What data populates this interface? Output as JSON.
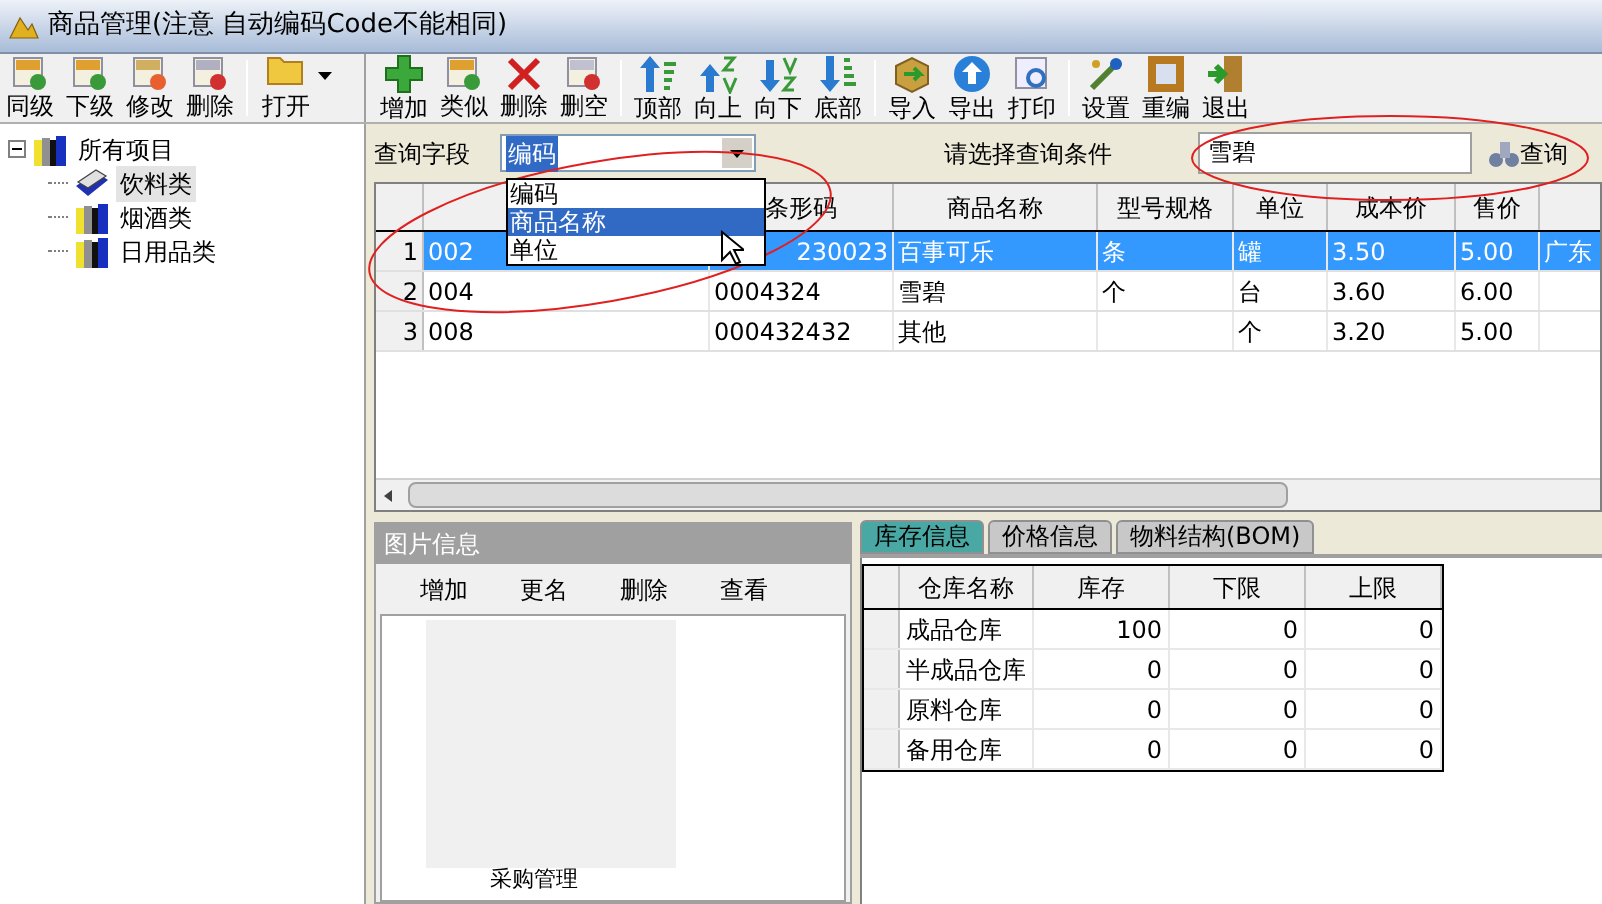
{
  "window": {
    "title": "商品管理(注意 自动编码Code不能相同)"
  },
  "tree_toolbar": {
    "buttons": [
      "同级",
      "下级",
      "修改",
      "删除"
    ],
    "open_button": "打开"
  },
  "main_toolbar": {
    "groups": [
      [
        "增加",
        "类似",
        "删除",
        "删空"
      ],
      [
        "顶部",
        "向上",
        "向下",
        "底部"
      ],
      [
        "导入",
        "导出",
        "打印"
      ],
      [
        "设置",
        "重编",
        "退出"
      ]
    ]
  },
  "tree": {
    "items": [
      {
        "label": "所有项目",
        "expanded": true,
        "selected": false,
        "children": [
          {
            "label": "饮料类",
            "selected": true
          },
          {
            "label": "烟酒类",
            "selected": false
          },
          {
            "label": "日用品类",
            "selected": false
          }
        ]
      }
    ]
  },
  "query": {
    "field_label": "查询字段",
    "field_value": "编码",
    "options": [
      {
        "label": "编码",
        "selected": false
      },
      {
        "label": "商品名称",
        "selected": true
      },
      {
        "label": "单位",
        "selected": false
      }
    ],
    "condition_label": "请选择查询条件",
    "search_value": "雪碧",
    "search_button": "查询"
  },
  "table": {
    "columns": [
      "",
      "条形码",
      "商品名称",
      "型号规格",
      "单位",
      "成本价",
      "售价",
      ""
    ],
    "rows": [
      {
        "index": "1",
        "selected": true,
        "cells": [
          "002",
          "230023",
          "百事可乐",
          "条",
          "罐",
          "3.50",
          "5.00",
          "广东"
        ]
      },
      {
        "index": "2",
        "selected": false,
        "cells": [
          "004",
          "0004324",
          "雪碧",
          "个",
          "台",
          "3.60",
          "6.00",
          ""
        ]
      },
      {
        "index": "3",
        "selected": false,
        "cells": [
          "008",
          "000432432",
          "其他",
          "",
          "个",
          "3.20",
          "5.00",
          ""
        ]
      }
    ]
  },
  "picture_panel": {
    "title": "图片信息",
    "buttons": [
      "增加",
      "更名",
      "删除",
      "查看"
    ],
    "caption": "采购管理"
  },
  "tabs": [
    {
      "label": "库存信息",
      "selected": true
    },
    {
      "label": "价格信息",
      "selected": false
    },
    {
      "label": "物料结构(BOM)",
      "selected": false
    }
  ],
  "stock_table": {
    "columns": [
      "仓库名称",
      "库存",
      "下限",
      "上限"
    ],
    "rows": [
      [
        "成品仓库",
        "100",
        "0",
        "0"
      ],
      [
        "半成品仓库",
        "0",
        "0",
        "0"
      ],
      [
        "原料仓库",
        "0",
        "0",
        "0"
      ],
      [
        "备用仓库",
        "0",
        "0",
        "0"
      ]
    ]
  }
}
